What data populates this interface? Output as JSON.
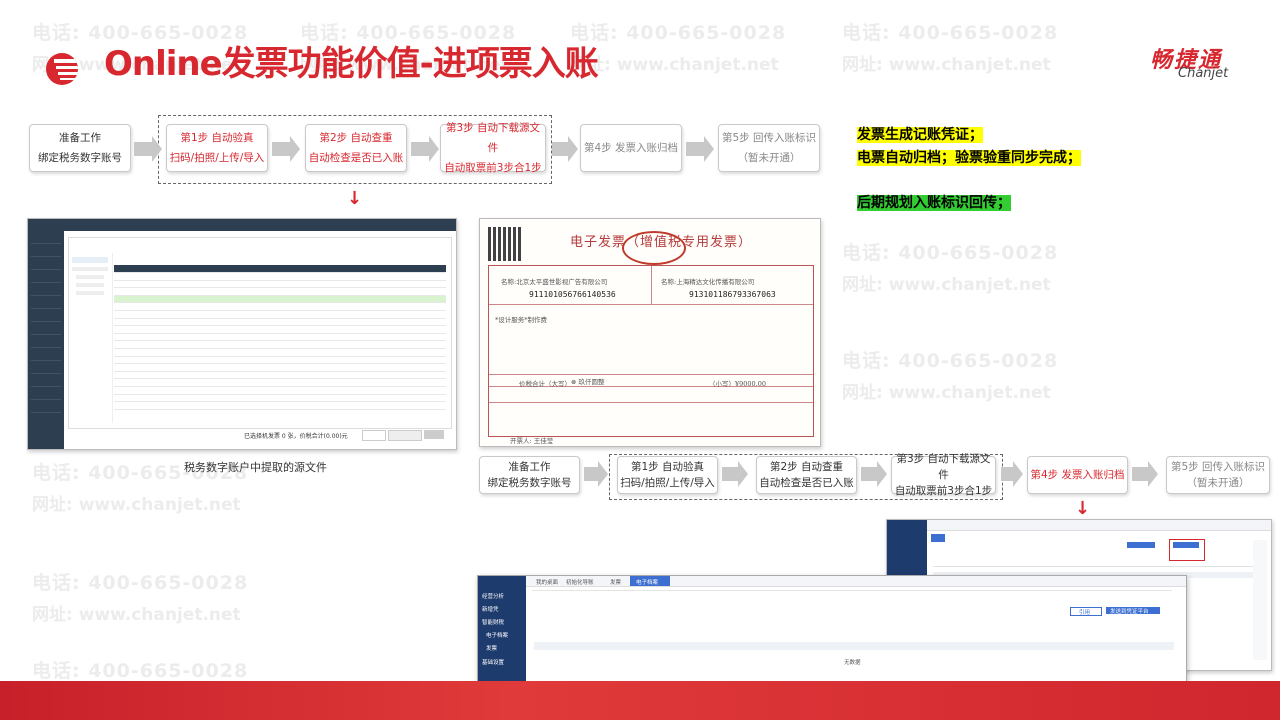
{
  "header": {
    "title": "Online发票功能价值-进项票入账",
    "logo_cn": "畅捷通",
    "logo_en": "Chanjet"
  },
  "watermark": {
    "phone": "电话: 400-665-0028",
    "site": "网址: www.chanjet.net"
  },
  "flow_top": {
    "steps": [
      {
        "line1": "准备工作",
        "line2": "绑定税务数字账号"
      },
      {
        "line1": "第1步 自动验真",
        "line2": "扫码/拍照/上传/导入"
      },
      {
        "line1": "第2步 自动查重",
        "line2": "自动检查是否已入账"
      },
      {
        "line1": "第3步 自动下载源文件",
        "line2": "自动取票前3步合1步"
      },
      {
        "line1": "第4步 发票入账归档",
        "line2": ""
      },
      {
        "line1": "第5步 回传入账标识",
        "line2": "（暂未开通）"
      }
    ]
  },
  "flow_bottom": {
    "steps": [
      {
        "line1": "准备工作",
        "line2": "绑定税务数字账号"
      },
      {
        "line1": "第1步 自动验真",
        "line2": "扫码/拍照/上传/导入"
      },
      {
        "line1": "第2步 自动查重",
        "line2": "自动检查是否已入账"
      },
      {
        "line1": "第3步 自动下载源文件",
        "line2": "自动取票前3步合1步"
      },
      {
        "line1": "第4步 发票入账归档",
        "line2": ""
      },
      {
        "line1": "第5步 回传入账标识",
        "line2": "（暂未开通）"
      }
    ]
  },
  "notes": {
    "line1": "发票生成记账凭证；",
    "line2": "电票自动归档；验票验重同步完成；",
    "line3": "后期规划入账标识回传；"
  },
  "screenshot1": {
    "caption": "税务数字账户中提取的源文件",
    "footer": "已选择机发票 0 张，价税合计(0.00)元"
  },
  "invoice": {
    "title": "电子发票",
    "subtitle": "（增值税专用发票）",
    "buyer": "名称:北京太平盛世影视广告有限公司",
    "buyer_tax": "91110105676614053​6",
    "seller": "名称:上海精达文化传播有限公司",
    "seller_tax": "913101186793367063",
    "item": "*设计服务*制作费",
    "total_label": "价税合计（大写）",
    "total_cn": "⊗ 玖仟圆整",
    "total_num": "（小写）¥9000.00",
    "issuer": "开票人: 王佳莹"
  },
  "screenshot4": {
    "tabs": [
      "我的桌面",
      "初始化导账",
      "发票",
      "电子档案"
    ],
    "left_menu": [
      "经营分析",
      "新增凭",
      "智能财税",
      "电子档案",
      "发票",
      "基础设置"
    ],
    "buttons": [
      "引用",
      "发送到凭证平台"
    ],
    "section": "无数据"
  }
}
